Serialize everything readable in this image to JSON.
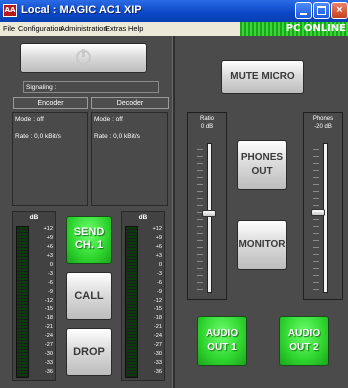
{
  "window": {
    "icon_text": "AA",
    "title": "Local : MAGIC AC1 XIP",
    "status": "PC ONLINE",
    "close_glyph": "×"
  },
  "menu": [
    "File",
    "Configuration",
    "Administration",
    "Extras",
    "Help"
  ],
  "left": {
    "signaling_label": "Signaling :",
    "encoder_header": "Encoder",
    "decoder_header": "Decoder",
    "encoder_mode": "Mode : off",
    "encoder_rate": "Rate :  0,0 kBit/s",
    "decoder_mode": "Mode : off",
    "decoder_rate": "Rate :  0,0 kBit/s",
    "vu_label": "dB",
    "vu_scale": [
      "+12",
      "+9",
      "+6",
      "+3",
      "0",
      "-3",
      "-6",
      "-9",
      "-12",
      "-15",
      "-18",
      "-21",
      "-24",
      "-27",
      "-30",
      "-33",
      "-36"
    ],
    "send_line1": "SEND",
    "send_line2": "CH. 1",
    "call": "CALL",
    "drop": "DROP"
  },
  "right": {
    "mute": "MUTE MICRO",
    "ratio_label": "Ratio",
    "ratio_value": "0 dB",
    "phones_label": "Phones",
    "phones_value": "-20 dB",
    "phones_out_line1": "PHONES",
    "phones_out_line2": "OUT",
    "monitor": "MONITOR",
    "audio_out1_line1": "AUDIO",
    "audio_out1_line2": "OUT 1",
    "audio_out2_line1": "AUDIO",
    "audio_out2_line2": "OUT 2"
  },
  "colors": {
    "active_green": "#2fd52f",
    "titlebar_blue": "#0a47c7",
    "panel_grey": "#4b4b4b"
  },
  "icons": {
    "power": "power-icon"
  }
}
